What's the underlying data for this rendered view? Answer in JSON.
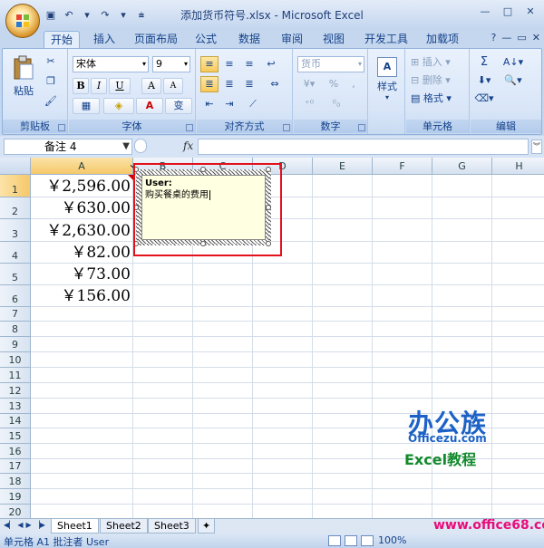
{
  "window": {
    "title": "添加货币符号.xlsx - Microsoft Excel",
    "controls": [
      "—",
      "□",
      "✕"
    ]
  },
  "ribbon": {
    "tabs": [
      "开始",
      "插入",
      "页面布局",
      "公式",
      "数据",
      "审阅",
      "视图",
      "开发工具",
      "加载项"
    ],
    "active_tab": "开始",
    "help_icon": "?",
    "clipboard": {
      "label": "剪贴板",
      "paste": "粘贴"
    },
    "font": {
      "label": "字体",
      "name": "宋体",
      "size": "9",
      "bold": "B",
      "italic": "I",
      "underline": "U",
      "grow": "A",
      "shrink": "A",
      "phonetic": "变"
    },
    "alignment": {
      "label": "对齐方式"
    },
    "number": {
      "label": "数字",
      "format": "货币",
      "percent": "%",
      "comma": ","
    },
    "styles": {
      "label": "样式"
    },
    "cells": {
      "label": "单元格",
      "insert": "插入",
      "delete": "删除",
      "format": "格式"
    },
    "editing": {
      "label": "编辑",
      "sum": "Σ"
    }
  },
  "formula_bar": {
    "name_box": "备注 4",
    "fx": "fx",
    "value": ""
  },
  "grid": {
    "columns": [
      "A",
      "B",
      "C",
      "D",
      "E",
      "F",
      "G",
      "H"
    ],
    "rows": [
      "1",
      "2",
      "3",
      "4",
      "5",
      "6",
      "7",
      "8",
      "9",
      "10",
      "11",
      "12",
      "13",
      "14",
      "15",
      "16",
      "17",
      "18",
      "19",
      "20"
    ],
    "cells_A": [
      "￥2,596.00",
      "￥630.00",
      "￥2,630.00",
      "￥82.00",
      "￥73.00",
      "￥156.00"
    ]
  },
  "comment": {
    "author": "User:",
    "text": "购买餐桌的费用"
  },
  "sheets": [
    "Sheet1",
    "Sheet2",
    "Sheet3"
  ],
  "status": {
    "text": "单元格 A1 批注者 User",
    "zoom": "100%"
  },
  "watermark": {
    "brand": "办公族",
    "site": "Officezu.com",
    "course": "Excel教程",
    "url": "www.office68.com"
  },
  "colors": {
    "highlight": "#e3111c",
    "comment_bg": "#ffffe1",
    "ribbon_text": "#15428b"
  }
}
